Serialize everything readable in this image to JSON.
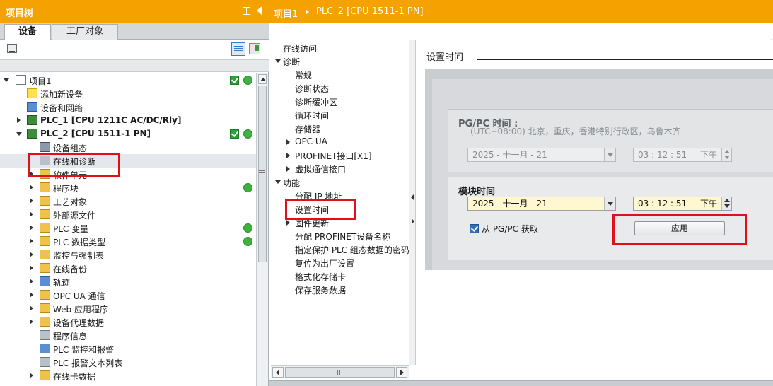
{
  "left_pane": {
    "title": "项目树",
    "tabs": [
      "设备",
      "工厂对象"
    ],
    "tree": [
      {
        "label": "项目1",
        "level": 0,
        "expander": "d",
        "icon": "i-doc",
        "bold": false,
        "check": true,
        "dot": true
      },
      {
        "label": "添加新设备",
        "level": 1,
        "expander": "",
        "icon": "i-star",
        "bold": false,
        "check": false,
        "dot": false
      },
      {
        "label": "设备和网络",
        "level": 1,
        "expander": "",
        "icon": "i-net",
        "bold": false,
        "check": false,
        "dot": false
      },
      {
        "label": "PLC_1 [CPU 1211C AC/DC/Rly]",
        "level": 1,
        "expander": "r",
        "icon": "i-plc",
        "bold": true,
        "check": false,
        "dot": false
      },
      {
        "label": "PLC_2 [CPU 1511-1 PN]",
        "level": 1,
        "expander": "d",
        "icon": "i-plc",
        "bold": true,
        "check": true,
        "dot": true
      },
      {
        "label": "设备组态",
        "level": 2,
        "expander": "",
        "icon": "i-tool",
        "bold": false,
        "check": false,
        "dot": false
      },
      {
        "label": "在线和诊断",
        "level": 2,
        "expander": "",
        "icon": "i-grey",
        "bold": false,
        "check": false,
        "dot": false,
        "selected": true
      },
      {
        "label": "软件单元",
        "level": 2,
        "expander": "r",
        "icon": "i-folder",
        "bold": false,
        "check": false,
        "dot": false
      },
      {
        "label": "程序块",
        "level": 2,
        "expander": "r",
        "icon": "i-folder",
        "bold": false,
        "check": false,
        "dot": true
      },
      {
        "label": "工艺对象",
        "level": 2,
        "expander": "r",
        "icon": "i-folder",
        "bold": false,
        "check": false,
        "dot": false
      },
      {
        "label": "外部源文件",
        "level": 2,
        "expander": "r",
        "icon": "i-folder",
        "bold": false,
        "check": false,
        "dot": false
      },
      {
        "label": "PLC 变量",
        "level": 2,
        "expander": "r",
        "icon": "i-folder",
        "bold": false,
        "check": false,
        "dot": true
      },
      {
        "label": "PLC 数据类型",
        "level": 2,
        "expander": "r",
        "icon": "i-folder",
        "bold": false,
        "check": false,
        "dot": true
      },
      {
        "label": "监控与强制表",
        "level": 2,
        "expander": "r",
        "icon": "i-folder",
        "bold": false,
        "check": false,
        "dot": false
      },
      {
        "label": "在线备份",
        "level": 2,
        "expander": "r",
        "icon": "i-folder",
        "bold": false,
        "check": false,
        "dot": false
      },
      {
        "label": "轨迹",
        "level": 2,
        "expander": "r",
        "icon": "i-blue",
        "bold": false,
        "check": false,
        "dot": false
      },
      {
        "label": "OPC UA 通信",
        "level": 2,
        "expander": "r",
        "icon": "i-folder",
        "bold": false,
        "check": false,
        "dot": false
      },
      {
        "label": "Web 应用程序",
        "level": 2,
        "expander": "r",
        "icon": "i-folder",
        "bold": false,
        "check": false,
        "dot": false
      },
      {
        "label": "设备代理数据",
        "level": 2,
        "expander": "r",
        "icon": "i-folder",
        "bold": false,
        "check": false,
        "dot": false
      },
      {
        "label": "程序信息",
        "level": 2,
        "expander": "",
        "icon": "i-grey",
        "bold": false,
        "check": false,
        "dot": false
      },
      {
        "label": "PLC 监控和报警",
        "level": 2,
        "expander": "",
        "icon": "i-blue",
        "bold": false,
        "check": false,
        "dot": false
      },
      {
        "label": "PLC 报警文本列表",
        "level": 2,
        "expander": "",
        "icon": "i-grey",
        "bold": false,
        "check": false,
        "dot": false
      },
      {
        "label": "在线卡数据",
        "level": 2,
        "expander": "r",
        "icon": "i-folder",
        "bold": false,
        "check": false,
        "dot": false
      }
    ]
  },
  "right_pane": {
    "breadcrumb_project": "项目1",
    "breadcrumb_device": "PLC_2 [CPU 1511-1 PN]"
  },
  "nav": [
    {
      "label": "在线访问",
      "level": 0,
      "expander": ""
    },
    {
      "label": "诊断",
      "level": 0,
      "expander": "d"
    },
    {
      "label": "常规",
      "level": 1,
      "expander": ""
    },
    {
      "label": "诊断状态",
      "level": 1,
      "expander": ""
    },
    {
      "label": "诊断缓冲区",
      "level": 1,
      "expander": ""
    },
    {
      "label": "循环时间",
      "level": 1,
      "expander": ""
    },
    {
      "label": "存储器",
      "level": 1,
      "expander": ""
    },
    {
      "label": "OPC UA",
      "level": 1,
      "expander": "r"
    },
    {
      "label": "PROFINET接口[X1]",
      "level": 1,
      "expander": "r"
    },
    {
      "label": "虚拟通信接口",
      "level": 1,
      "expander": "r"
    },
    {
      "label": "功能",
      "level": 0,
      "expander": "d"
    },
    {
      "label": "分配 IP 地址",
      "level": 1,
      "expander": ""
    },
    {
      "label": "设置时间",
      "level": 1,
      "expander": "",
      "selected": true
    },
    {
      "label": "固件更新",
      "level": 1,
      "expander": "r"
    },
    {
      "label": "分配 PROFINET设备名称",
      "level": 1,
      "expander": ""
    },
    {
      "label": "指定保护 PLC 组态数据的密码",
      "level": 1,
      "expander": ""
    },
    {
      "label": "复位为出厂设置",
      "level": 1,
      "expander": ""
    },
    {
      "label": "格式化存储卡",
      "level": 1,
      "expander": ""
    },
    {
      "label": "保存服务数据",
      "level": 1,
      "expander": ""
    }
  ],
  "content": {
    "section_title": "设置时间",
    "pgpc": {
      "title": "PG/PC 时间 :",
      "timezone": "(UTC+08:00) 北京，重庆，香港特别行政区，乌鲁木齐",
      "date": "2025 - 十一月  - 21",
      "time": "03 : 12 : 51",
      "ampm": "下午"
    },
    "module": {
      "title": "模块时间",
      "date": "2025 - 十一月  - 21",
      "time": "03 : 12 : 51",
      "ampm": "下午",
      "checkbox_label": "从 PG/PC 获取",
      "checkbox_checked": true,
      "apply_label": "应用"
    }
  },
  "colors": {
    "header_orange": "#f5a100",
    "highlight_red": "#e0101a",
    "status_green": "#2ea13c"
  }
}
